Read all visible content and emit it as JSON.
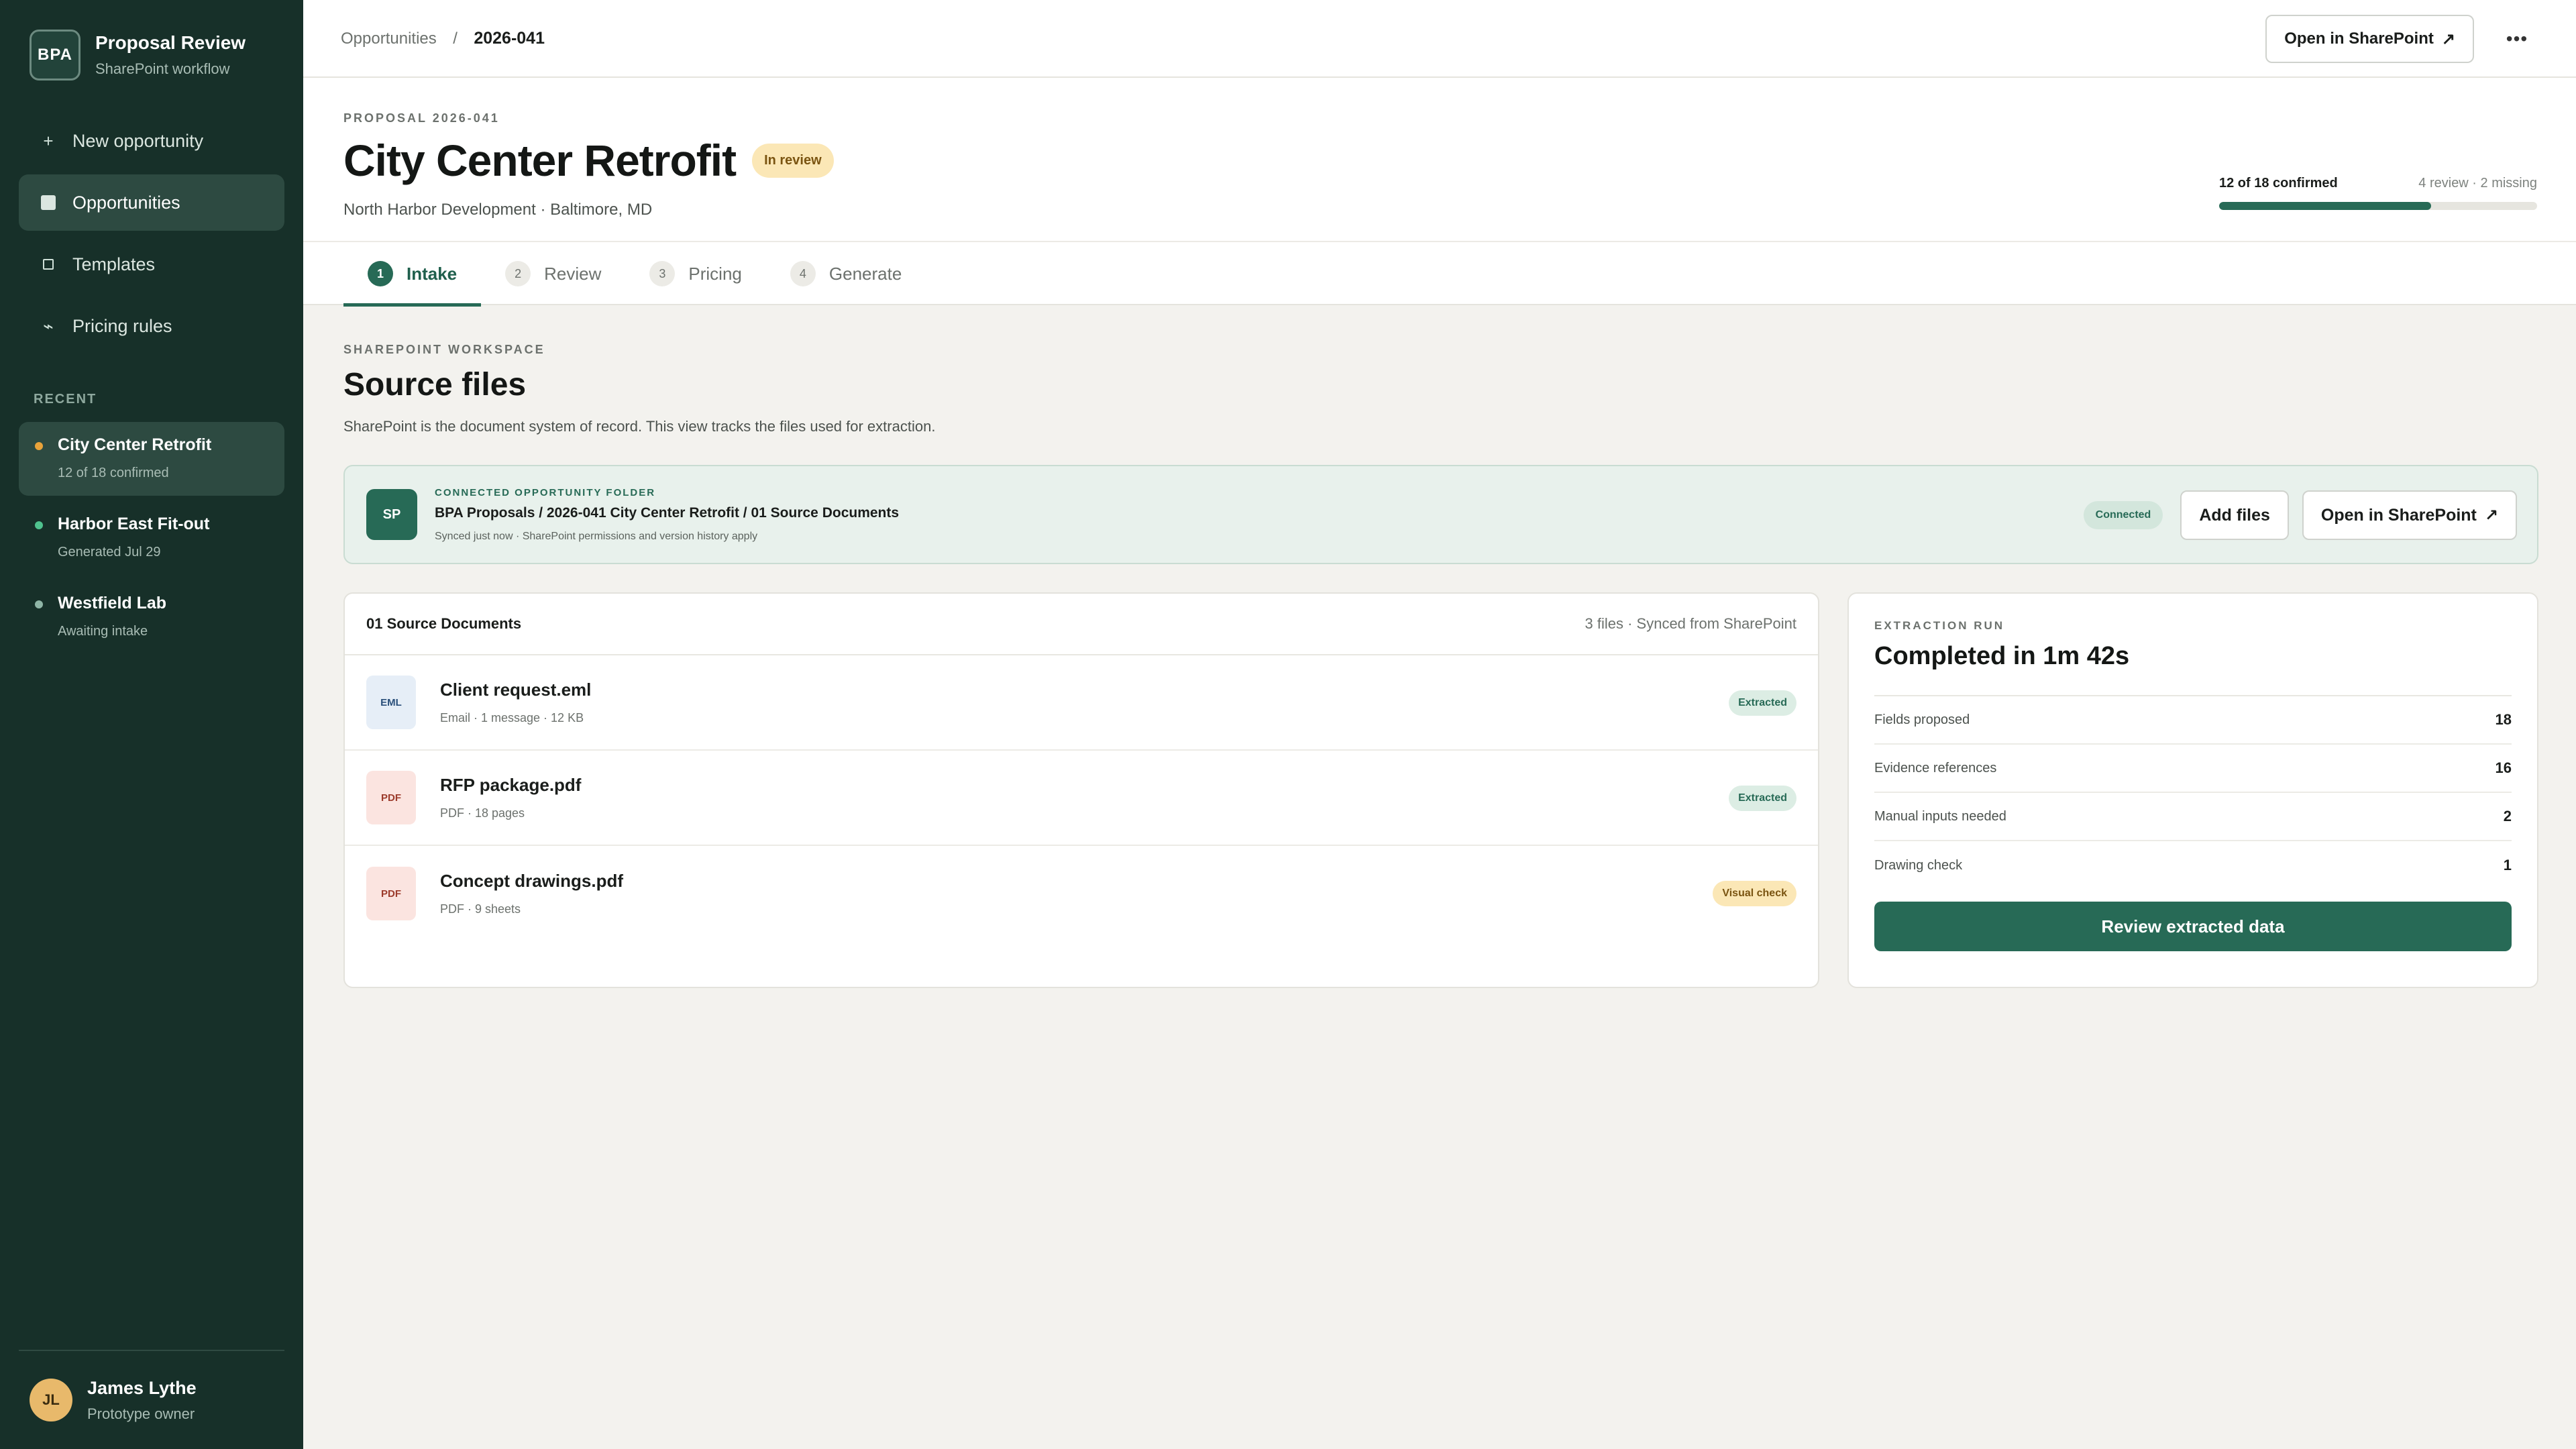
{
  "brand": {
    "logo": "BPA",
    "title": "Proposal Review",
    "subtitle": "SharePoint workflow"
  },
  "nav": {
    "new_opportunity": {
      "icon": "+",
      "label": "New opportunity"
    },
    "items": [
      {
        "label": "Opportunities",
        "icon": "opportunities-icon",
        "active": true
      },
      {
        "label": "Templates",
        "icon": "templates-icon"
      },
      {
        "label": "Pricing rules",
        "icon": "pricing-rules-icon",
        "glyph": "⌁"
      }
    ]
  },
  "recent": {
    "heading": "RECENT",
    "items": [
      {
        "title": "City Center Retrofit",
        "subtitle": "12 of 18 confirmed",
        "dot_color": "#e8a33a",
        "active": true
      },
      {
        "title": "Harbor East Fit-out",
        "subtitle": "Generated Jul 29",
        "dot_color": "#4fc28e"
      },
      {
        "title": "Westfield Lab",
        "subtitle": "Awaiting intake",
        "dot_color": "#8fb5a6"
      }
    ]
  },
  "user": {
    "initials": "JL",
    "name": "James Lythe",
    "role": "Prototype owner"
  },
  "topbar": {
    "breadcrumb_parent": "Opportunities",
    "breadcrumb_sep": "/",
    "breadcrumb_current": "2026-041",
    "open_sharepoint": "Open in SharePoint",
    "ext_glyph": "↗",
    "more_glyph": "•••"
  },
  "header": {
    "eyebrow": "PROPOSAL 2026-041",
    "title": "City Center Retrofit",
    "status": "In review",
    "client": "North Harbor Development · Baltimore, MD",
    "progress": {
      "label": "12 of 18 confirmed",
      "detail": "4 review · 2 missing",
      "confirmed": 12,
      "total": 18
    }
  },
  "tabs": [
    {
      "num": "1",
      "label": "Intake",
      "active": true
    },
    {
      "num": "2",
      "label": "Review"
    },
    {
      "num": "3",
      "label": "Pricing"
    },
    {
      "num": "4",
      "label": "Generate"
    }
  ],
  "section": {
    "eyebrow": "SHAREPOINT WORKSPACE",
    "title": "Source files",
    "description": "SharePoint is the document system of record. This view tracks the files used for extraction."
  },
  "folder": {
    "icon": "SP",
    "eyebrow": "CONNECTED OPPORTUNITY FOLDER",
    "path": "BPA Proposals / 2026-041 City Center Retrofit / 01 Source Documents",
    "sub": "Synced just now · SharePoint permissions and version history apply",
    "status": "Connected",
    "add_files": "Add files",
    "open_sharepoint": "Open in SharePoint"
  },
  "files": {
    "title": "01 Source Documents",
    "meta": "3 files · Synced from SharePoint",
    "rows": [
      {
        "type": "EML",
        "kind": "eml",
        "name": "Client request.eml",
        "meta": "Email · 1 message · 12 KB",
        "status": "Extracted",
        "status_kind": "ok"
      },
      {
        "type": "PDF",
        "kind": "pdf",
        "name": "RFP package.pdf",
        "meta": "PDF · 18 pages",
        "status": "Extracted",
        "status_kind": "ok"
      },
      {
        "type": "PDF",
        "kind": "pdf",
        "name": "Concept drawings.pdf",
        "meta": "PDF · 9 sheets",
        "status": "Visual check",
        "status_kind": "warn"
      }
    ]
  },
  "run": {
    "eyebrow": "EXTRACTION RUN",
    "title": "Completed in 1m 42s",
    "rows": [
      {
        "label": "Fields proposed",
        "value": "18"
      },
      {
        "label": "Evidence references",
        "value": "16"
      },
      {
        "label": "Manual inputs needed",
        "value": "2"
      },
      {
        "label": "Drawing check",
        "value": "1"
      }
    ],
    "button": "Review extracted data"
  },
  "colors": {
    "sidebar": "#173029",
    "accent": "#276a56",
    "warning_bg": "#fbe7b6"
  }
}
